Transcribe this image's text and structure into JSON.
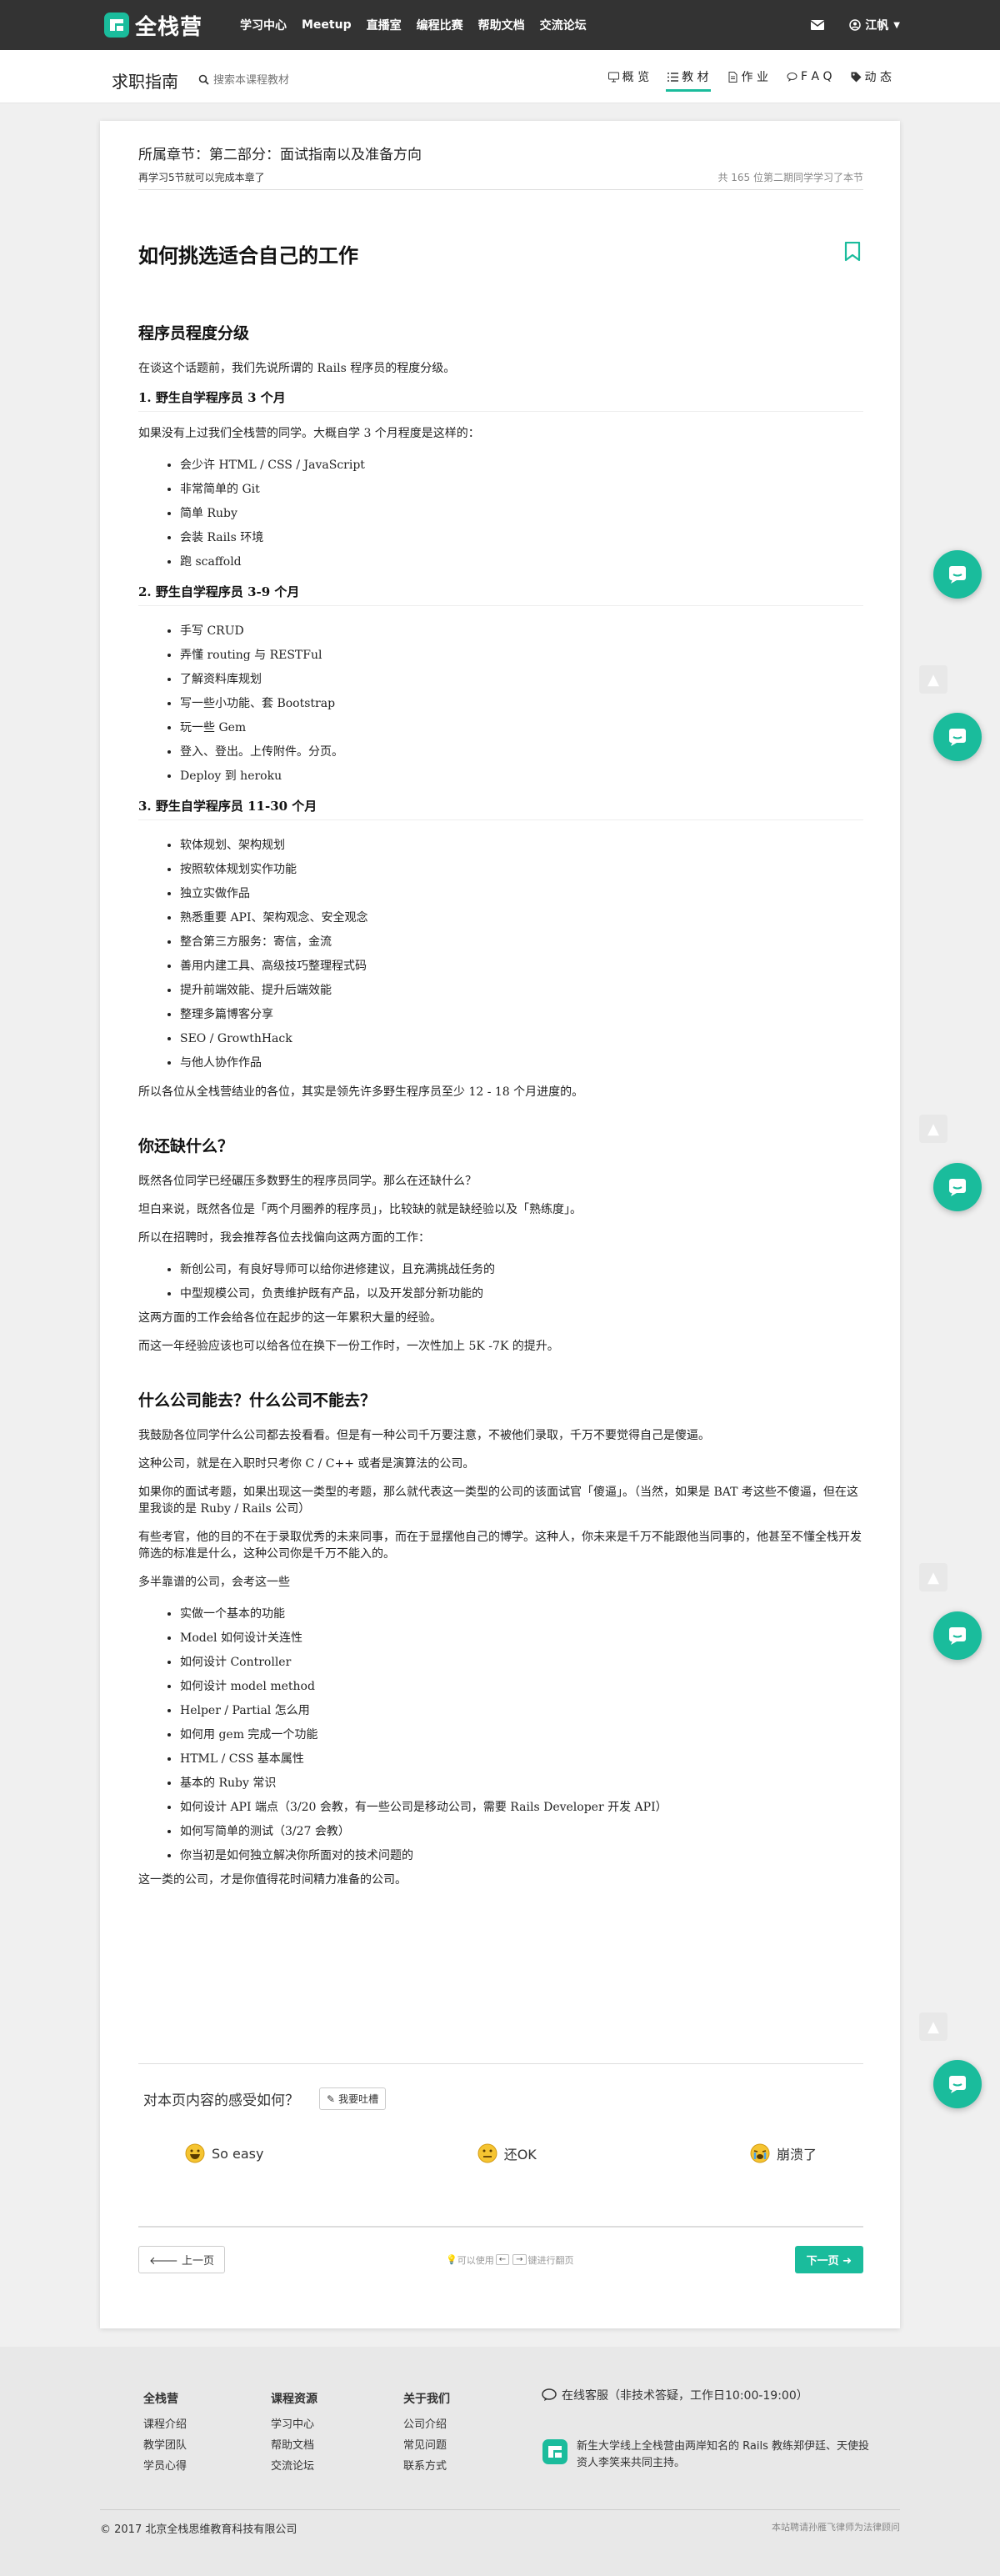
{
  "nav": {
    "brand": "全栈营",
    "links": [
      "学习中心",
      "Meetup",
      "直播室",
      "编程比赛",
      "帮助文档",
      "交流论坛"
    ],
    "user": "江帆"
  },
  "subnav": {
    "course_title": "求职指南",
    "search_placeholder": "搜索本课程教材",
    "tabs": [
      "概 览",
      "教 材",
      "作 业",
      "F A Q",
      "动 态"
    ]
  },
  "section": {
    "chapter": "所属章节：第二部分：面试指南以及准备方向",
    "remaining": "再学习5节就可以完成本章了",
    "learner_rank": "共 165 位第二期同学学习了本节"
  },
  "article": {
    "title": "如何挑选适合自己的工作",
    "h_levels": "程序员程度分级",
    "p_intro": "在谈这个话题前，我们先说所谓的 Rails 程序员的程度分级。",
    "h_l1": "1. 野生自学程序员 3 个月",
    "p_l1": "如果没有上过我们全栈营的同学。大概自学 3 个月程度是这样的：",
    "list_l1": [
      "会少许 HTML / CSS / JavaScript",
      "非常简单的 Git",
      "简单 Ruby",
      "会装 Rails 环境",
      "跑 scaffold"
    ],
    "h_l2": "2. 野生自学程序员 3-9 个月",
    "list_l2": [
      "手写 CRUD",
      "弄懂 routing 与 RESTFul",
      "了解资料库规划",
      "写一些小功能、套 Bootstrap",
      "玩一些 Gem",
      "登入、登出。上传附件。分页。",
      "Deploy 到 heroku"
    ],
    "h_l3": "3. 野生自学程序员 11-30 个月",
    "list_l3": [
      "软体规划、架构规划",
      "按照软体规划实作功能",
      "独立实做作品",
      "熟悉重要 API、架构观念、安全观念",
      "整合第三方服务：寄信，金流",
      "善用内建工具、高级技巧整理程式码",
      "提升前端效能、提升后端效能",
      "整理多篇博客分享",
      "SEO / GrowthHack",
      "与他人协作作品"
    ],
    "p_l3_summary": "所以各位从全栈营结业的各位，其实是领先许多野生程序员至少 12 - 18 个月进度的。",
    "h_lack": "你还缺什么？",
    "p_lack1": "既然各位同学已经碾压多数野生的程序员同学。那么在还缺什么？",
    "p_lack2": "坦白来说，既然各位是「两个月圈养的程序员」，比较缺的就是缺经验以及「熟练度」。",
    "p_lack3": "所以在招聘时，我会推荐各位去找偏向这两方面的工作：",
    "list_lack": [
      "新创公司，有良好导师可以给你进修建议，且充满挑战任务的",
      "中型规模公司，负责维护既有产品，以及开发部分新功能的"
    ],
    "p_lack4": "这两方面的工作会给各位在起步的这一年累积大量的经验。",
    "p_lack5": "而这一年经验应该也可以给各位在换下一份工作时，一次性加上 5K -7K 的提升。",
    "h_company": "什么公司能去？什么公司不能去？",
    "p_c1": "我鼓励各位同学什么公司都去投看看。但是有一种公司千万要注意，不被他们录取，千万不要觉得自己是傻逼。",
    "p_c2": "这种公司，就是在入职时只考你 C / C++ 或者是演算法的公司。",
    "p_c3": "如果你的面试考题，如果出现这一类型的考题，那么就代表这一类型的公司的该面试官「傻逼」。（当然，如果是 BAT 考这些不傻逼，但在这里我谈的是 Ruby / Rails 公司）",
    "p_c4": "有些考官，他的目的不在于录取优秀的未来同事，而在于显摆他自己的博学。这种人，你未来是千万不能跟他当同事的，他甚至不懂全栈开发筛选的标准是什么，这种公司你是千万不能入的。",
    "p_c5": "多半靠谱的公司，会考这一些",
    "list_c": [
      "实做一个基本的功能",
      "Model 如何设计关连性",
      "如何设计 Controller",
      "如何设计 model method",
      "Helper / Partial 怎么用",
      "如何用 gem 完成一个功能",
      "HTML / CSS 基本属性",
      "基本的 Ruby 常识",
      "如何设计 API 端点（3/20 会教，有一些公司是移动公司，需要 Rails Developer 开发 API）",
      "如何写简单的测试（3/27 会教）",
      "你当初是如何独立解决你所面对的技术问题的"
    ],
    "p_c6": "这一类的公司，才是你值得花时间精力准备的公司。"
  },
  "feedback": {
    "question": "对本页内容的感受如何？",
    "button": "我要吐槽",
    "reactions": [
      "So easy",
      "还OK",
      "崩溃了"
    ]
  },
  "pager": {
    "prev": "上一页",
    "hint_pre": "可以使用",
    "key_left": "←",
    "key_right": "→",
    "hint_post": "键进行翻页",
    "next": "下一页"
  },
  "footer": {
    "col1_title": "全栈营",
    "col1": [
      "课程介绍",
      "教学团队",
      "学员心得"
    ],
    "col2_title": "课程资源",
    "col2": [
      "学习中心",
      "帮助文档",
      "交流论坛"
    ],
    "col3_title": "关于我们",
    "col3": [
      "公司介绍",
      "常见问题",
      "联系方式"
    ],
    "service": "在线客服（非技术答疑，工作日10:00-19:00）",
    "intro": "新生大学线上全栈营由两岸知名的 Rails 教练郑伊廷、天使投资人李笑来共同主持。",
    "copyright": "© 2017 北京全栈思维教育科技有限公司",
    "legal": "本站聘请孙雁飞律师为法律顾问"
  },
  "colors": {
    "accent": "#1ABC9C",
    "topbar": "#333333"
  }
}
